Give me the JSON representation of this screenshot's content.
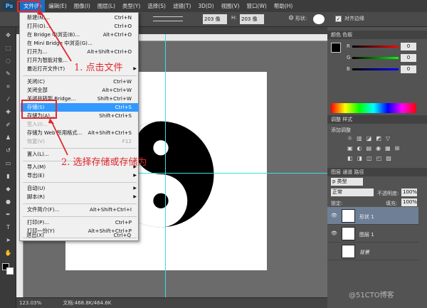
{
  "menubar": {
    "logo": "Ps",
    "items": [
      "文件(F)",
      "编辑(E)",
      "图像(I)",
      "图层(L)",
      "类型(Y)",
      "选择(S)",
      "滤镜(T)",
      "3D(D)",
      "视图(V)",
      "窗口(W)",
      "帮助(H)"
    ]
  },
  "options": {
    "w_value": "203 像",
    "h_label": "H:",
    "h_value": "203 像",
    "shape_label": "形状:",
    "align_edges": "对齐边缘"
  },
  "file_menu": {
    "items": [
      {
        "label": "新建(N)...",
        "shortcut": "Ctrl+N"
      },
      {
        "label": "打开(O)...",
        "shortcut": "Ctrl+O"
      },
      {
        "label": "在 Bridge 中浏览(B)...",
        "shortcut": "Alt+Ctrl+O"
      },
      {
        "label": "在 Mini Bridge 中浏览(G)...",
        "shortcut": ""
      },
      {
        "label": "打开为...",
        "shortcut": "Alt+Shift+Ctrl+O"
      },
      {
        "label": "打开为智能对象...",
        "shortcut": ""
      },
      {
        "label": "最近打开文件(T)",
        "shortcut": ""
      },
      {
        "label": "关闭(C)",
        "shortcut": "Ctrl+W"
      },
      {
        "label": "关闭全部",
        "shortcut": "Alt+Ctrl+W"
      },
      {
        "label": "关闭并转到 Bridge...",
        "shortcut": "Shift+Ctrl+W"
      },
      {
        "label": "存储(S)",
        "shortcut": "Ctrl+S"
      },
      {
        "label": "存储为(A)...",
        "shortcut": "Shift+Ctrl+S"
      },
      {
        "label": "签入(I)...",
        "shortcut": ""
      },
      {
        "label": "存储为 Web 所用格式...",
        "shortcut": "Alt+Shift+Ctrl+S"
      },
      {
        "label": "恢复(V)",
        "shortcut": "F12"
      },
      {
        "label": "置入(L)...",
        "shortcut": ""
      },
      {
        "label": "导入(M)",
        "shortcut": ""
      },
      {
        "label": "导出(E)",
        "shortcut": ""
      },
      {
        "label": "自动(U)",
        "shortcut": ""
      },
      {
        "label": "脚本(R)",
        "shortcut": ""
      },
      {
        "label": "文件简介(F)...",
        "shortcut": "Alt+Shift+Ctrl+I"
      },
      {
        "label": "打印(P)...",
        "shortcut": "Ctrl+P"
      },
      {
        "label": "打印一份(Y)",
        "shortcut": "Alt+Shift+Ctrl+P"
      },
      {
        "label": "退出(X)",
        "shortcut": "Ctrl+Q"
      }
    ]
  },
  "annotations": {
    "step1": "1. 点击文件",
    "step2": "2. 选择存储或存储为"
  },
  "color_panel": {
    "tabs": "颜色  色板",
    "r_label": "R",
    "g_label": "G",
    "b_label": "B",
    "r_value": "0",
    "g_value": "0",
    "b_value": "0"
  },
  "adjust_panel": {
    "tabs": "调整  样式",
    "add_label": "添加调整"
  },
  "layers_panel": {
    "tabs": "图层  通道  路径",
    "kind": "p 类型",
    "blend_mode": "正常",
    "opacity_label": "不透明度:",
    "opacity_value": "100%",
    "lock_label": "锁定:",
    "fill_label": "填充:",
    "fill_value": "100%",
    "layers": [
      "形状 1",
      "图层 1",
      "背景"
    ]
  },
  "statusbar": {
    "zoom": "123.03%",
    "doc": "文档:468.8K/464.6K"
  },
  "watermark": "@51CTO博客",
  "colors": {
    "accent": "#3399ff",
    "annotation": "#e0282e",
    "guide": "#35e0e0"
  }
}
